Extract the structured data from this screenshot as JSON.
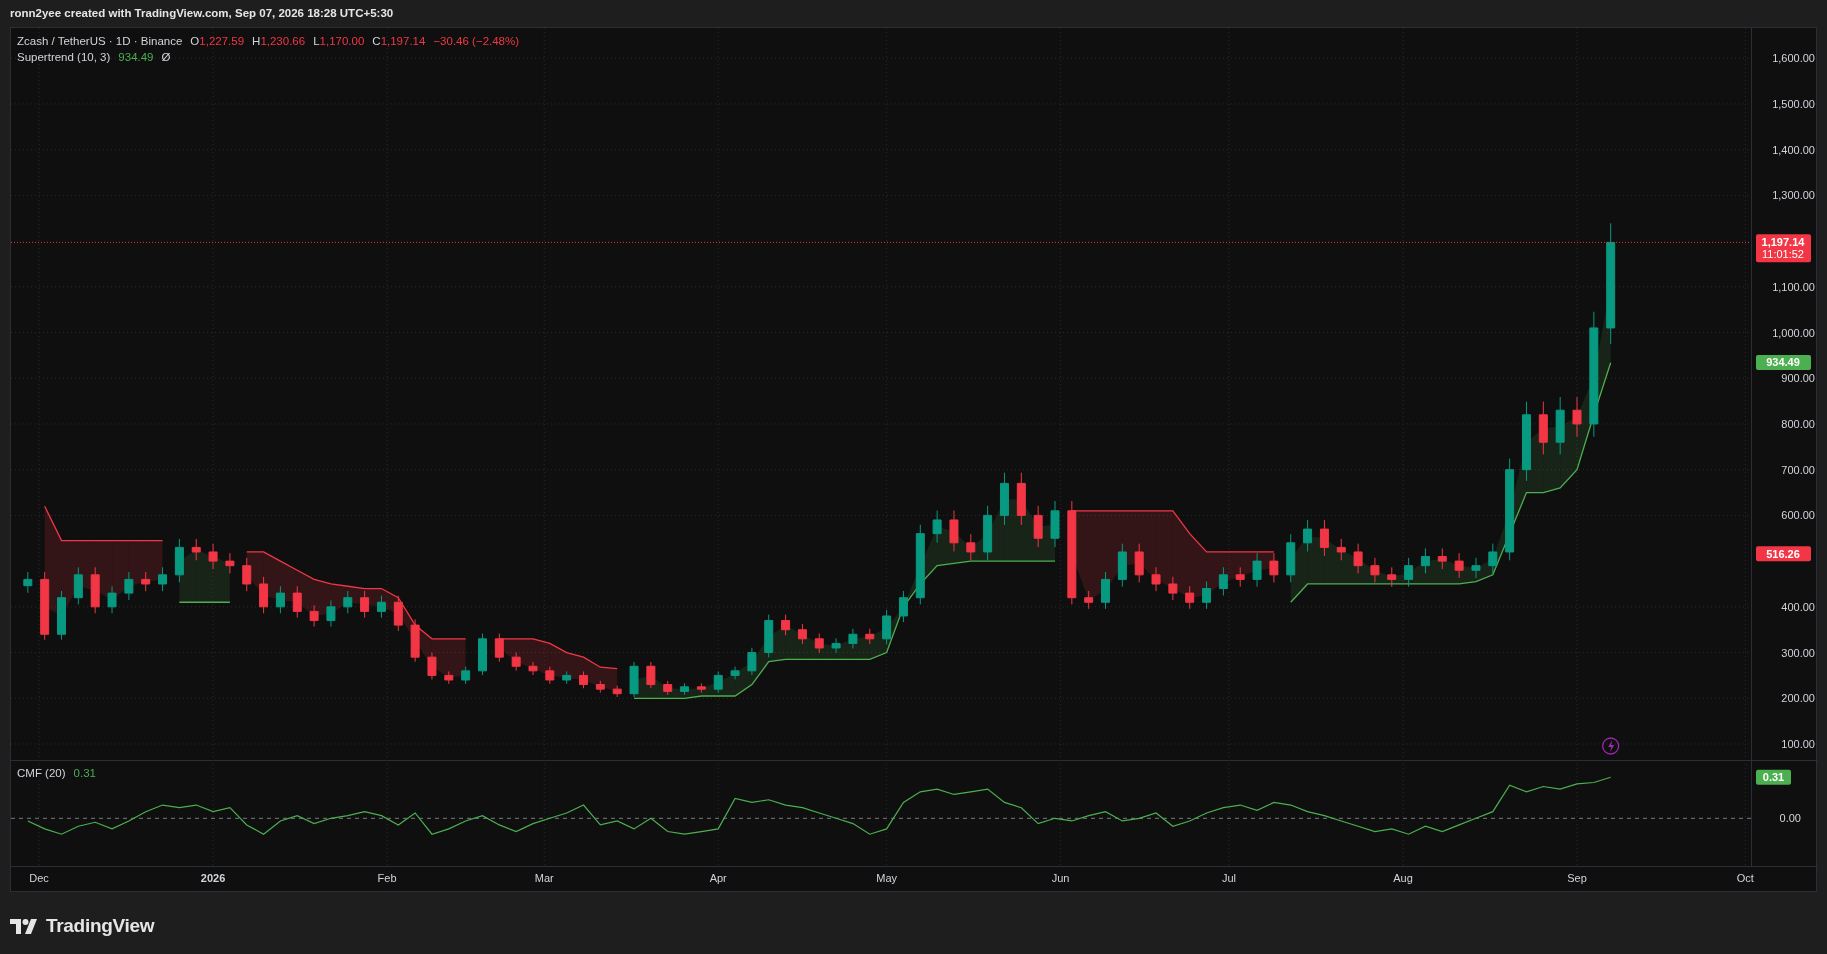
{
  "header": "ronn2yee created with TradingView.com, Sep 07, 2026 18:28 UTC+5:30",
  "legend": {
    "symbol": "Zcash / TetherUS · 1D · Binance",
    "falling": true,
    "ohlc": [
      {
        "label": "O",
        "value": "1,227.59"
      },
      {
        "label": "H",
        "value": "1,230.66"
      },
      {
        "label": "L",
        "value": "1,170.00"
      },
      {
        "label": "C",
        "value": "1,197.14"
      }
    ],
    "change": "−30.46 (−2.48%)"
  },
  "indicator": {
    "name": "Supertrend (10, 3)",
    "value": "934.49",
    "mark": "Ø"
  },
  "price_axis": [
    "1,600.00",
    "1,500.00",
    "1,400.00",
    "1,300.00",
    "1,100.00",
    "1,000.00",
    "900.00",
    "800.00",
    "700.00",
    "600.00",
    "400.00",
    "300.00",
    "200.00",
    "100.00"
  ],
  "price_badges": [
    {
      "text": "1,197.14",
      "subtext": "11:01:52",
      "color": "#f23645"
    },
    {
      "text": "934.49",
      "color": "#4caf50"
    },
    {
      "text": "516.26",
      "color": "#f23645"
    }
  ],
  "cmf": {
    "name": "CMF (20)",
    "value": "0.31",
    "axis_label": "0.00",
    "badge": {
      "text": "0.31",
      "color": "#4caf50"
    }
  },
  "time_axis": [
    "Dec",
    "2026",
    "Feb",
    "Mar",
    "Apr",
    "May",
    "Jun",
    "Jul",
    "Aug",
    "Sep",
    "Oct"
  ],
  "brand": "TradingView"
}
